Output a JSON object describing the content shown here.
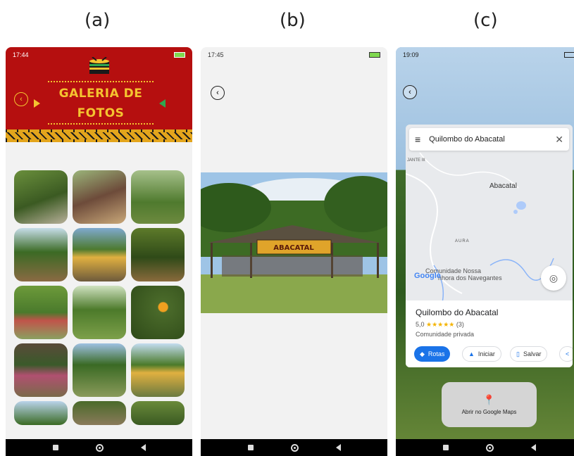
{
  "labels": {
    "a": "(a)",
    "b": "(b)",
    "c": "(c)"
  },
  "panel_a": {
    "status_time": "17:44",
    "title_line1": "GALERIA DE",
    "title_line2": "FOTOS",
    "colors": {
      "header": "#b50f0f",
      "title": "#f4c430"
    }
  },
  "panel_b": {
    "status_time": "17:45"
  },
  "panel_c": {
    "status_time": "19:09",
    "search_text": "Quilombo do Abacatal",
    "map_labels": {
      "abacatal": "Abacatal",
      "aura": "AURA",
      "jante": "JANTE III",
      "comunidade": "Comunidade Nossa",
      "navegantes": "nhora dos Navegantes"
    },
    "google_logo": "Google",
    "place_name": "Quilombo do Abacatal",
    "rating": "5,0",
    "stars": "★★★★★",
    "review_count": "(3)",
    "place_type": "Comunidade privada",
    "btn_routes": "Rotas",
    "btn_start": "Iniciar",
    "btn_save": "Salvar",
    "open_maps": "Abrir no Google Maps",
    "colors": {
      "primary": "#1a73e8"
    }
  }
}
